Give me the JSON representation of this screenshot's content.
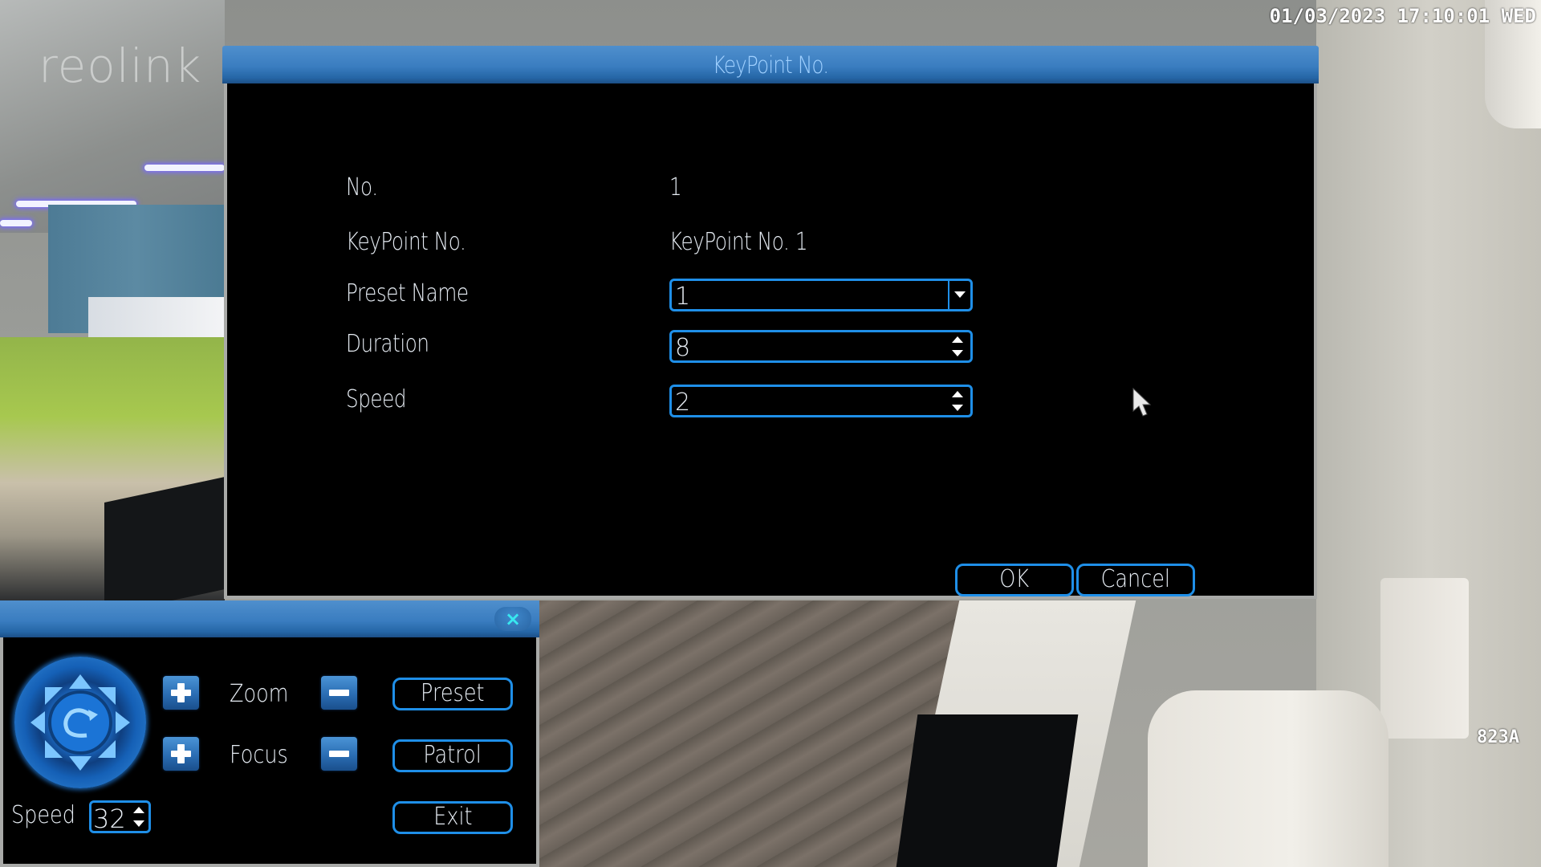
{
  "overlay": {
    "brand_logo": "reolink",
    "timestamp": "01/03/2023 17:10:01 WED",
    "camera_label": "823A"
  },
  "dialog": {
    "title": "KeyPoint No.",
    "fields": [
      {
        "label": "No.",
        "value": "1",
        "type": "text"
      },
      {
        "label": "KeyPoint No.",
        "value": "KeyPoint No. 1",
        "type": "text"
      },
      {
        "label": "Preset Name",
        "value": "1",
        "type": "dropdown"
      },
      {
        "label": "Duration",
        "value": "8",
        "type": "spinner"
      },
      {
        "label": "Speed",
        "value": "2",
        "type": "spinner"
      }
    ],
    "buttons": {
      "ok": "OK",
      "cancel": "Cancel"
    }
  },
  "ptz_panel": {
    "close_icon": "×",
    "joystick_icon": "ptz-direction-pad",
    "zoom_label": "Zoom",
    "focus_label": "Focus",
    "speed_label": "Speed",
    "speed_value": "32",
    "buttons": {
      "preset": "Preset",
      "patrol": "Patrol",
      "exit": "Exit"
    }
  },
  "colors": {
    "accent_blue": "#1f8fe8",
    "title_bar": "#3a7dc0",
    "title_text": "#9fd0ff",
    "text": "#e6ecf3"
  }
}
